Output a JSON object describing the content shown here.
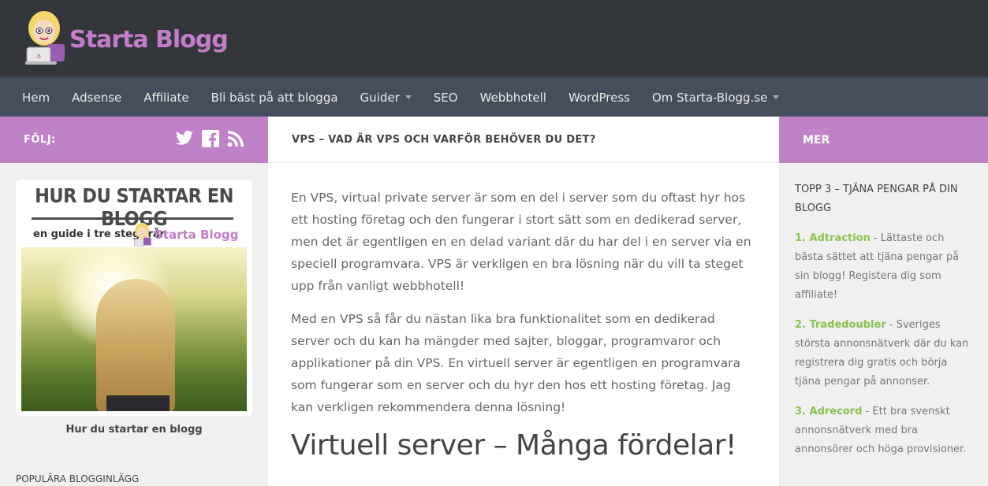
{
  "header": {
    "logo_text": "Starta Blogg"
  },
  "nav": {
    "items": [
      {
        "label": "Hem",
        "dropdown": false
      },
      {
        "label": "Adsense",
        "dropdown": false
      },
      {
        "label": "Affiliate",
        "dropdown": false
      },
      {
        "label": "Bli bäst på att blogga",
        "dropdown": false
      },
      {
        "label": "Guider",
        "dropdown": true
      },
      {
        "label": "SEO",
        "dropdown": false
      },
      {
        "label": "Webbhotell",
        "dropdown": false
      },
      {
        "label": "WordPress",
        "dropdown": false
      },
      {
        "label": "Om Starta-Blogg.se",
        "dropdown": true
      }
    ]
  },
  "left_sidebar": {
    "follow_label": "FÖLJ:",
    "social_icons": [
      "twitter-icon",
      "facebook-icon",
      "rss-icon"
    ],
    "guide_title": "HUR DU STARTAR EN BLOGG",
    "guide_subtitle": "en guide i tre steg från",
    "guide_logo_text": "Starta Blogg",
    "guide_caption": "Hur du startar en blogg",
    "popular_heading": "POPULÄRA BLOGGINLÄGG"
  },
  "main": {
    "post_title": "VPS – VAD ÄR VPS OCH VARFÖR BEHÖVER DU DET?",
    "paragraphs": [
      "En VPS, virtual private server är som en del i server som du oftast hyr hos ett hosting företag och den fungerar i stort sätt som en dedikerad server, men det är egentligen en en delad variant där du har del i en server via en speciell programvara. VPS är verkligen en bra lösning när du vill ta steget upp från vanligt webbhotell!",
      "Med en VPS så får du nästan lika bra funktionalitet som en dedikerad server och du kan ha mängder med sajter, bloggar, programvaror och applikationer på din VPS. En virtuell server är egentligen en programvara som fungerar som en server och du hyr den hos ett hosting företag. Jag kan verkligen rekommendera denna lösning!"
    ],
    "subheading": "Virtuell server – Många fördelar!"
  },
  "right_sidebar": {
    "bar_label": "MER",
    "widget_title": "TOPP 3 – TJÄNA PENGAR PÅ DIN BLOGG",
    "items": [
      {
        "name": "1. Adtraction",
        "text": " - Lättaste och bästa sättet att tjäna pengar på sin blogg! Registera dig som affiliate!"
      },
      {
        "name": "2. Tradedoubler",
        "text": " - Sveriges största annonsnätverk där du kan registrera dig gratis och börja tjäna pengar på annonser."
      },
      {
        "name": "3. Adrecord",
        "text": " - Ett bra svenskt annonsnätverk med bra annonsörer och höga provisioner."
      }
    ]
  },
  "colors": {
    "accent": "#c082c6",
    "header_bg": "#33363b",
    "nav_bg": "#454e5c",
    "link_green": "#8cc152"
  }
}
